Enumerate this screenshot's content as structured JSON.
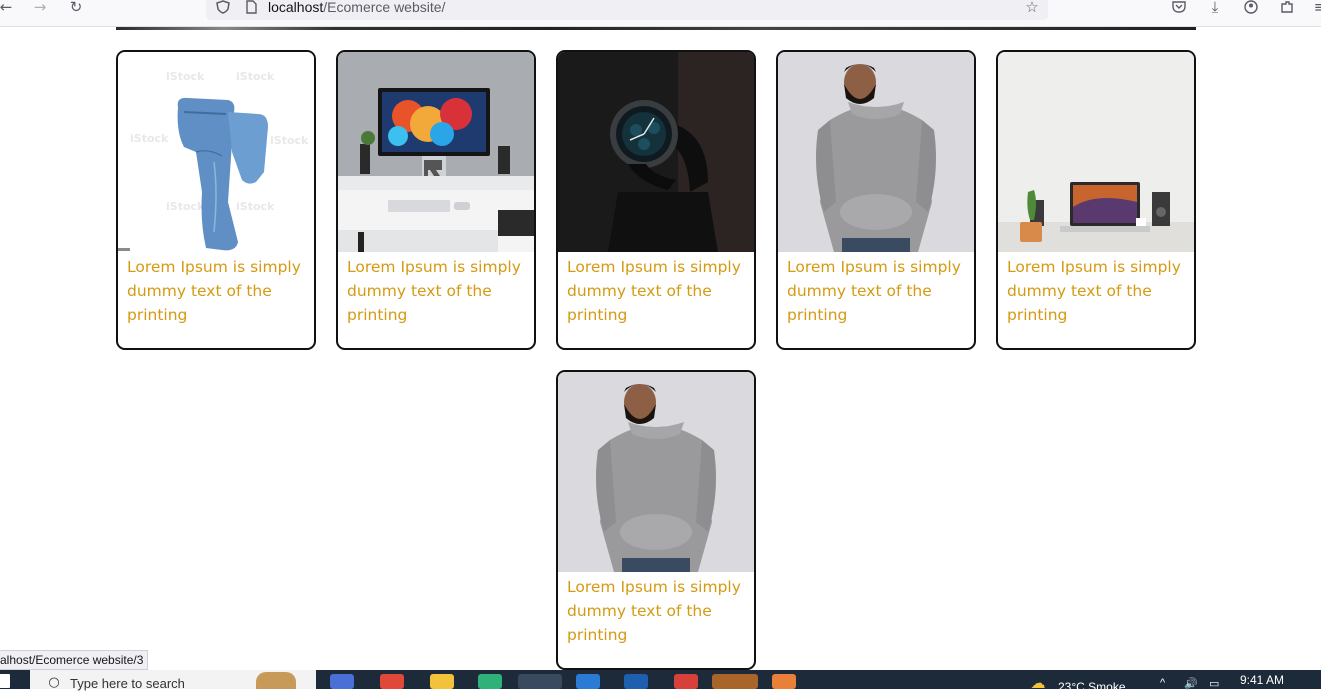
{
  "browser": {
    "url_host": "localhost",
    "url_path": "/Ecomerce website/",
    "icons": [
      "back-icon",
      "forward-icon",
      "reload-icon",
      "shield-icon",
      "page-icon",
      "star-icon",
      "pocket-icon",
      "download-icon",
      "account-icon",
      "extensions-icon",
      "menu-icon"
    ]
  },
  "products": [
    {
      "caption": "Lorem Ipsum is simply dummy text of the printing",
      "image": "jeans"
    },
    {
      "caption": "Lorem Ipsum is simply dummy text of the printing",
      "image": "desk-monitor"
    },
    {
      "caption": "Lorem Ipsum is simply dummy text of the printing",
      "image": "wristwatch"
    },
    {
      "caption": "Lorem Ipsum is simply dummy text of the printing",
      "image": "man-hoodie"
    },
    {
      "caption": "Lorem Ipsum is simply dummy text of the printing",
      "image": "laptop-desk"
    },
    {
      "caption": "Lorem Ipsum is simply dummy text of the printing",
      "image": "man-hoodie"
    }
  ],
  "status_bar": {
    "link": "alhost/Ecomerce website/3"
  },
  "taskbar": {
    "search_placeholder": "Type here to search",
    "weather": "23°C  Smoke",
    "time": "9:41 AM"
  },
  "colors": {
    "caption": "#d59a12",
    "card_border": "#111111",
    "taskbar": "#1c2a3a"
  }
}
